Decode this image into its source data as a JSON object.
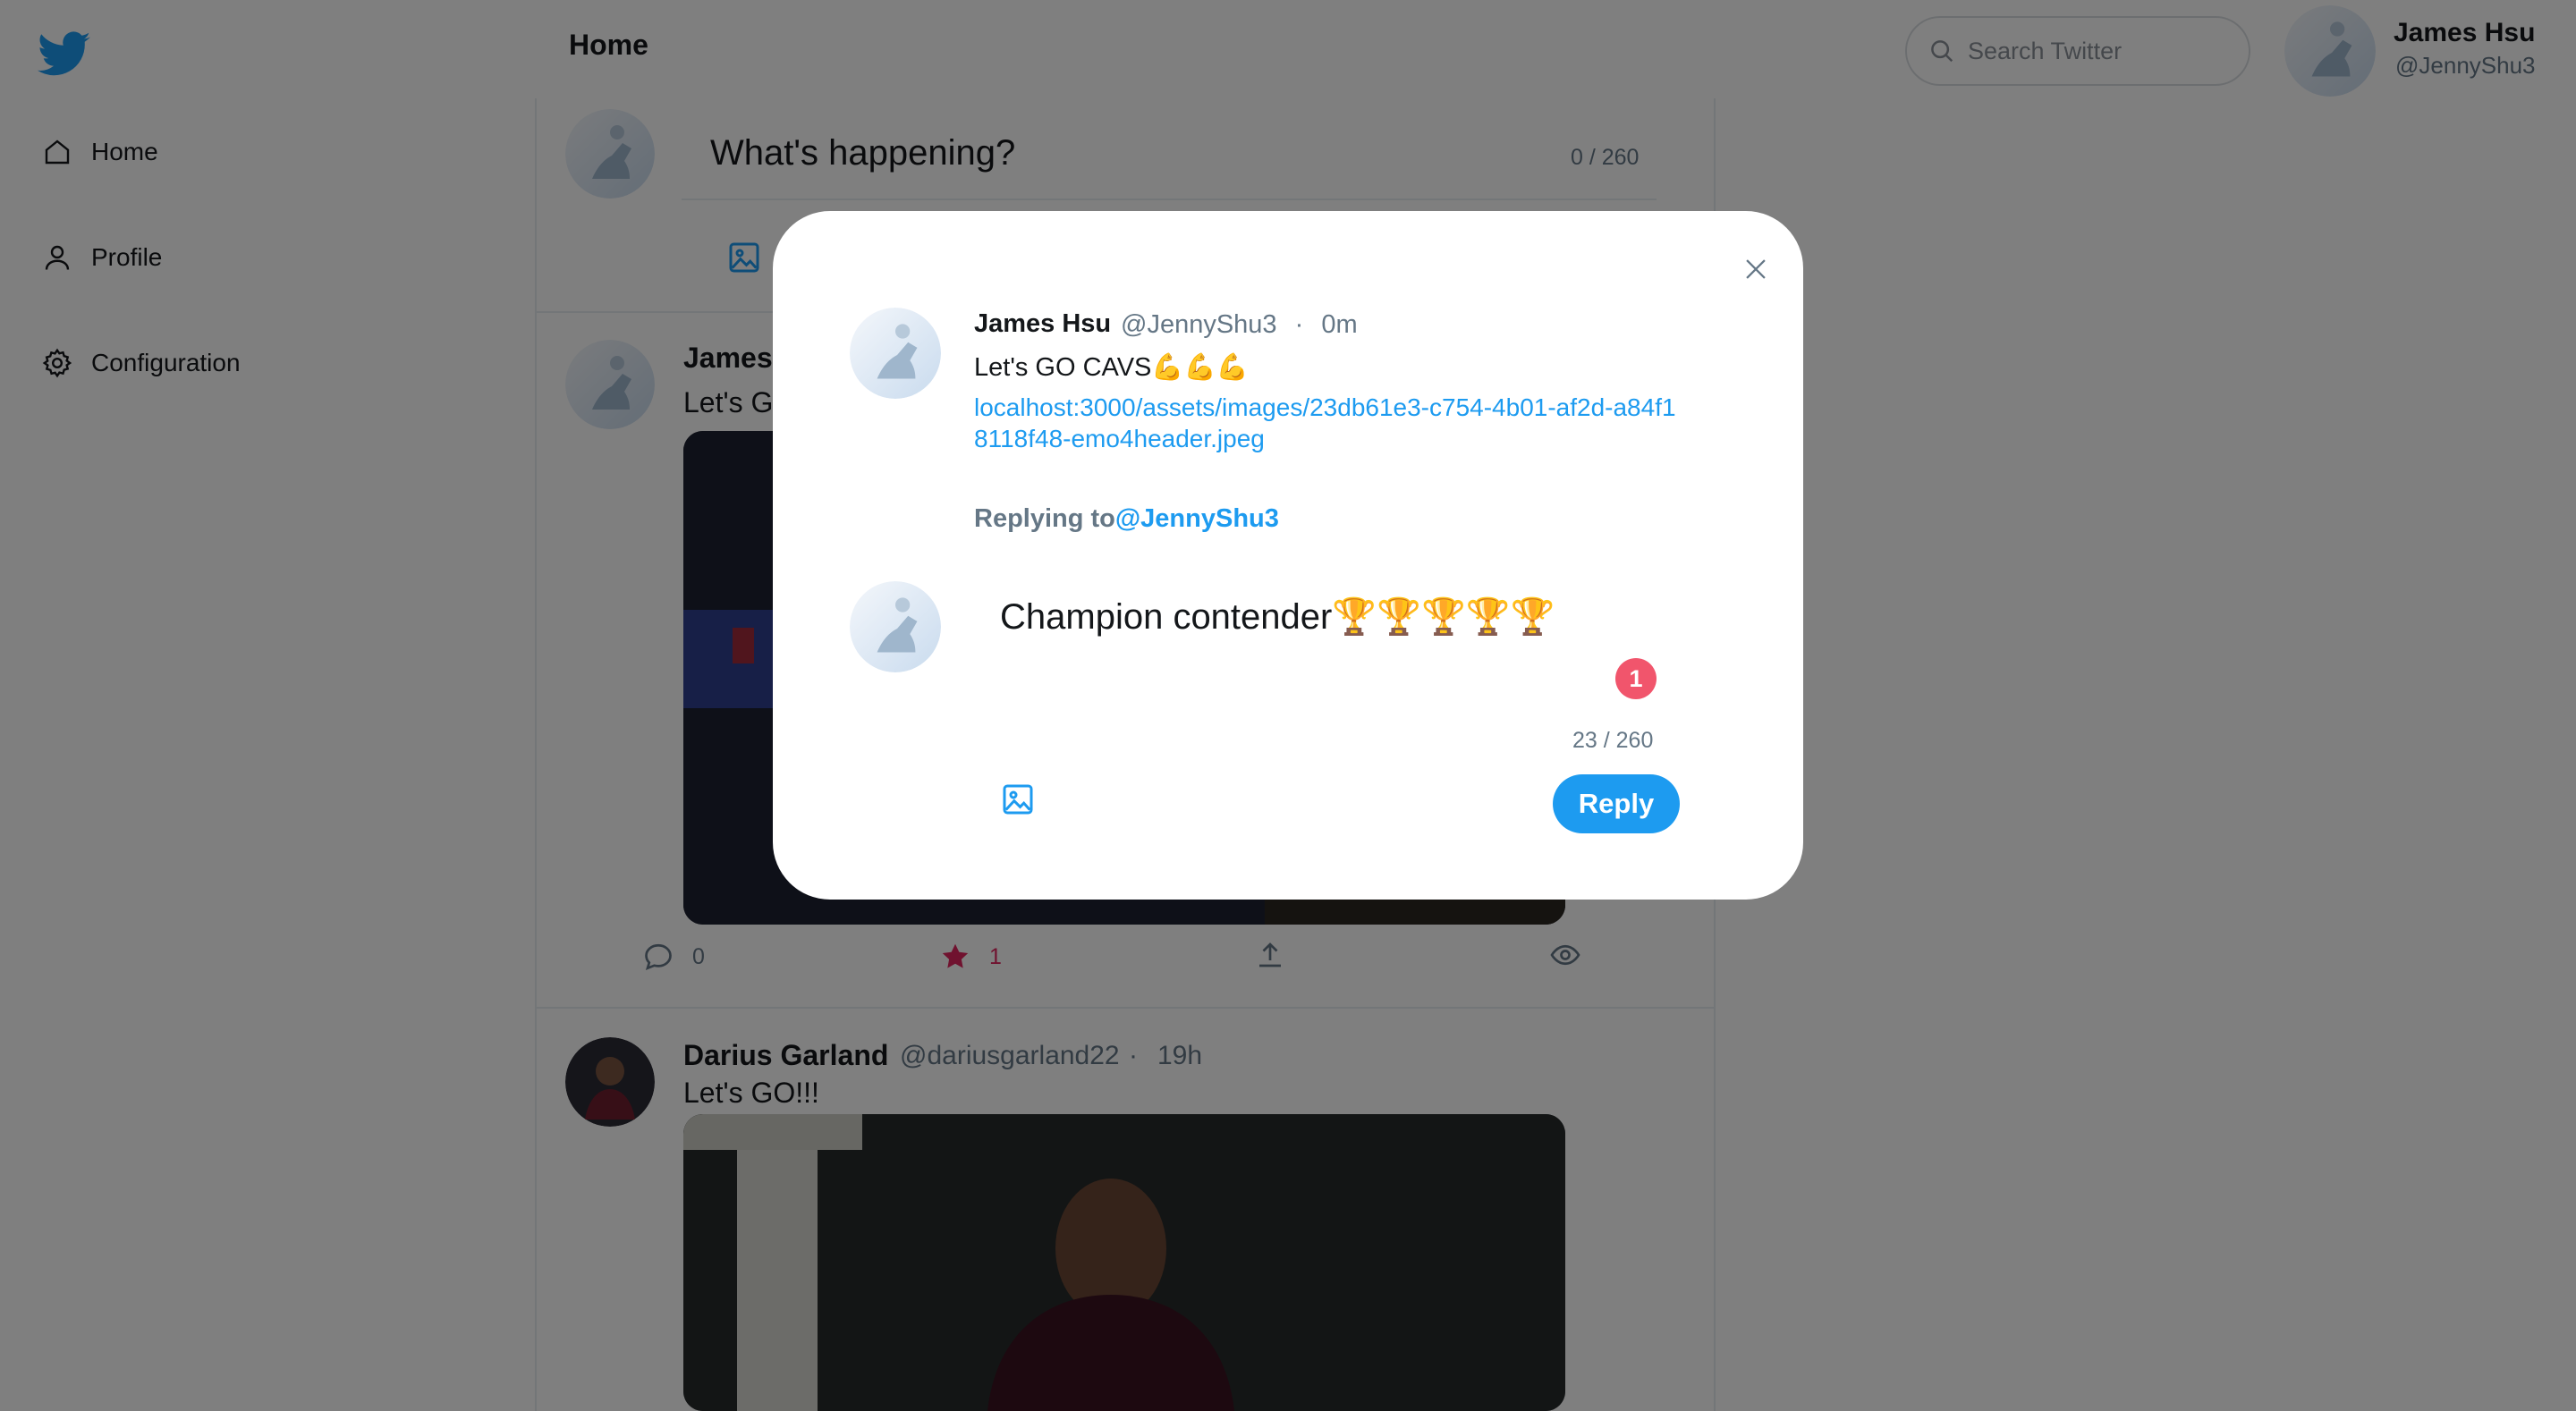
{
  "header": {
    "title": "Home"
  },
  "sidebar": {
    "items": [
      {
        "label": "Home",
        "icon": "home-icon"
      },
      {
        "label": "Profile",
        "icon": "user-icon"
      },
      {
        "label": "Configuration",
        "icon": "gear-icon"
      }
    ]
  },
  "search": {
    "placeholder": "Search Twitter"
  },
  "current_user": {
    "name": "James Hsu",
    "handle": "@JennyShu3"
  },
  "compose": {
    "placeholder": "What's happening?",
    "counter": "0 / 260"
  },
  "feed": {
    "posts": [
      {
        "name": "James",
        "text": "Let's G",
        "stats": {
          "replies": "0",
          "likes": "1"
        }
      },
      {
        "name": "Darius Garland",
        "handle": "@dariusgarland22",
        "separator": "·",
        "time": "19h",
        "text": "Let's GO!!!"
      }
    ]
  },
  "modal": {
    "tweet": {
      "name": "James Hsu",
      "handle": "@JennyShu3",
      "separator": "·",
      "time": "0m",
      "text": "Let's GO CAVS💪💪💪",
      "link": "localhost:3000/assets/images/23db61e3-c754-4b01-af2d-a84f18118f48-emo4header.jpeg"
    },
    "replying_label": "Replying to",
    "replying_handle": "@JennyShu3",
    "reply_text": "Champion contender🏆🏆🏆🏆🏆",
    "badge": "1",
    "counter": "23 / 260",
    "reply_button": "Reply"
  },
  "colors": {
    "accent": "#1d9bf0",
    "like": "#e0245e",
    "badge": "#f1556c",
    "overlay": "rgba(0,0,0,0.5)"
  }
}
